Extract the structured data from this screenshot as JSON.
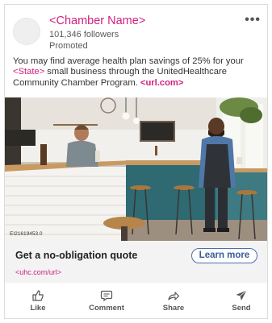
{
  "post": {
    "chamber_name": "<Chamber Name>",
    "followers": "101,346 followers",
    "promoted": "Promoted",
    "more": "•••"
  },
  "body": {
    "text_1": "You may find average health plan savings of 25% for your ",
    "state": "<State>",
    "text_2": " small business through the UnitedHealthcare Community Chamber Program. ",
    "url": "<url.com>"
  },
  "image": {
    "stock_id": "EI21619453.0"
  },
  "cta": {
    "title": "Get a no-obligation quote",
    "url": "<uhc.com/url>",
    "button": "Learn more"
  },
  "actions": {
    "like": "Like",
    "comment": "Comment",
    "share": "Share",
    "send": "Send"
  },
  "colors": {
    "brand_pink": "#d01f7e",
    "button_blue": "#3c5a96"
  }
}
